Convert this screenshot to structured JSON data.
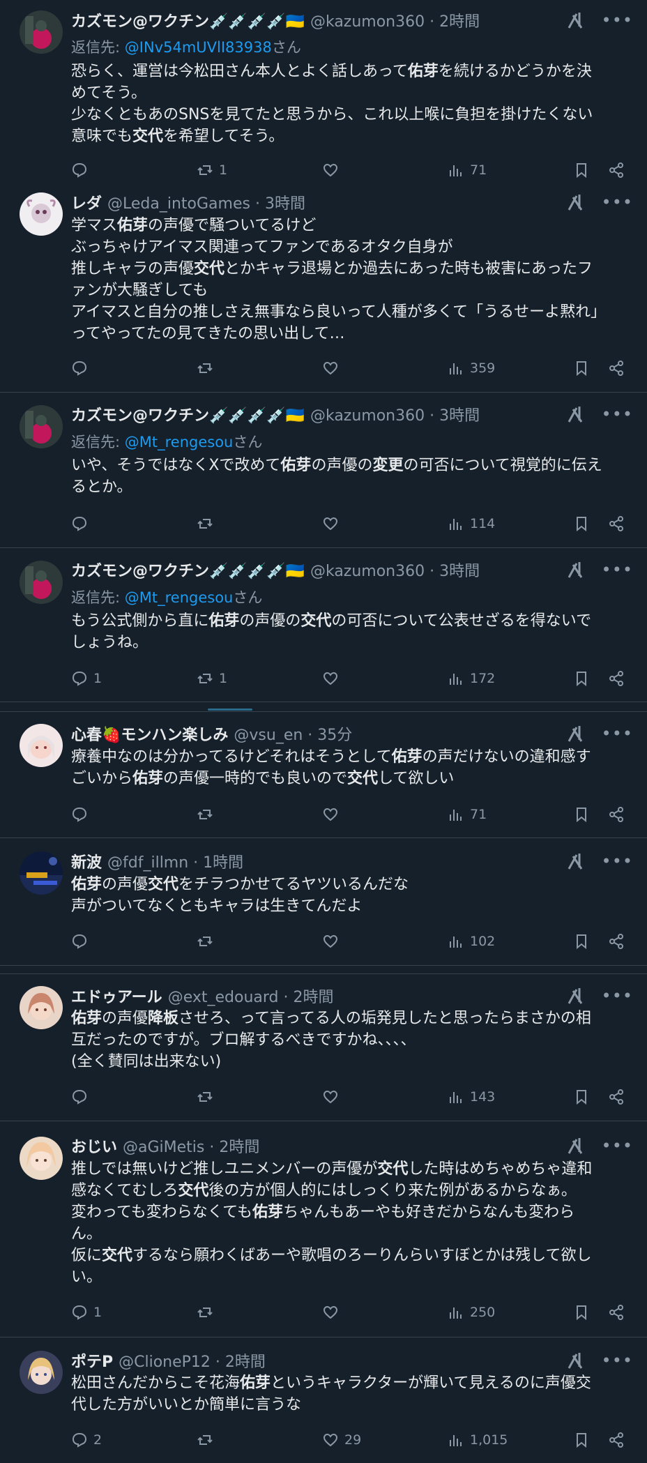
{
  "colors": {
    "background": "#15202b",
    "text": "#e7e9ea",
    "muted": "#8b98a5",
    "link": "#1d9bf0",
    "divider": "#38444d"
  },
  "icons": {
    "reply": "reply-icon",
    "repost": "repost-icon",
    "like": "heart-icon",
    "views": "views-icon",
    "bookmark": "bookmark-icon",
    "share": "share-icon",
    "grok": "grok-icon",
    "more": "more-icon"
  },
  "tweets": [
    {
      "name": "カズモン@ワクチン💉💉💉💉🇺🇦",
      "handle": "@kazumon360 · 2時間",
      "reply_label": "返信先: ",
      "reply_mention": "@INv54mUVlI83938",
      "reply_suffix": "さん",
      "lines": [
        "恐らく、運営は今松田さん本人とよく話しあって佑芽を続けるかどうかを決",
        "めてそう。",
        "少なくともあのSNSを見てたと思うから、これ以上喉に負担を掛けたくない",
        "意味でも交代を希望してそう。"
      ],
      "replies": "",
      "reposts": "1",
      "likes": "",
      "views": "71"
    },
    {
      "name": "レダ",
      "handle": "@Leda_intoGames · 3時間",
      "lines": [
        "学マス佑芽の声優で騒ついてるけど",
        "ぶっちゃけアイマス関連ってファンであるオタク自身が",
        "推しキャラの声優交代とかキャラ退場とか過去にあった時も被害にあったフ",
        "ァンが大騒ぎしても",
        "アイマスと自分の推しさえ無事なら良いって人種が多くて「うるせーよ黙れ」",
        "ってやってたの見てきたの思い出して…"
      ],
      "replies": "",
      "reposts": "",
      "likes": "",
      "views": "359"
    },
    {
      "name": "カズモン@ワクチン💉💉💉💉🇺🇦",
      "handle": "@kazumon360 · 3時間",
      "reply_label": "返信先: ",
      "reply_mention": "@Mt_rengesou",
      "reply_suffix": "さん",
      "lines": [
        "いや、そうではなくXで改めて佑芽の声優の変更の可否について視覚的に伝え",
        "るとか。"
      ],
      "replies": "",
      "reposts": "",
      "likes": "",
      "views": "114"
    },
    {
      "name": "カズモン@ワクチン💉💉💉💉🇺🇦",
      "handle": "@kazumon360 · 3時間",
      "reply_label": "返信先: ",
      "reply_mention": "@Mt_rengesou",
      "reply_suffix": "さん",
      "lines": [
        "もう公式側から直に佑芽の声優の交代の可否について公表せざるを得ないで",
        "しょうね。"
      ],
      "replies": "1",
      "reposts": "1",
      "likes": "",
      "views": "172"
    },
    {
      "name": "心春🍓モンハン楽しみ",
      "handle": "@vsu_en · 35分",
      "lines": [
        "療養中なのは分かってるけどそれはそうとして佑芽の声だけないの違和感す",
        "ごいから佑芽の声優一時的でも良いので交代して欲しい"
      ],
      "replies": "",
      "reposts": "",
      "likes": "",
      "views": "71"
    },
    {
      "name": "新波",
      "handle": "@fdf_illmn · 1時間",
      "lines": [
        "佑芽の声優交代をチラつかせてるヤツいるんだな",
        "声がついてなくともキャラは生きてんだよ"
      ],
      "replies": "",
      "reposts": "",
      "likes": "",
      "views": "102"
    },
    {
      "name": "エドゥアール",
      "handle": "@ext_edouard · 2時間",
      "lines": [
        "佑芽の声優降板させろ、って言ってる人の垢発見したと思ったらまさかの相",
        "互だったのですが。ブロ解するべきですかね、、、、",
        "(全く賛同は出来ない)"
      ],
      "replies": "",
      "reposts": "",
      "likes": "",
      "views": "143"
    },
    {
      "name": "おじい",
      "handle": "@aGiMetis · 2時間",
      "lines": [
        "推しでは無いけど推しユニメンバーの声優が交代した時はめちゃめちゃ違和",
        "感なくてむしろ交代後の方が個人的にはしっくり来た例があるからなぁ。",
        "変わっても変わらなくても佑芽ちゃんもあーやも好きだからなんも変わら",
        "ん。",
        "仮に交代するなら願わくばあーや歌唱のろーりんらいすぼとかは残して欲し",
        "い。"
      ],
      "replies": "1",
      "reposts": "",
      "likes": "",
      "views": "250"
    },
    {
      "name": "ポテP",
      "handle": "@ClioneP12 · 2時間",
      "lines": [
        "松田さんだからこそ花海佑芽というキャラクターが輝いて見えるのに声優交",
        "代した方がいいとか簡単に言うな"
      ],
      "replies": "2",
      "reposts": "",
      "likes": "29",
      "views": "1,015"
    }
  ]
}
